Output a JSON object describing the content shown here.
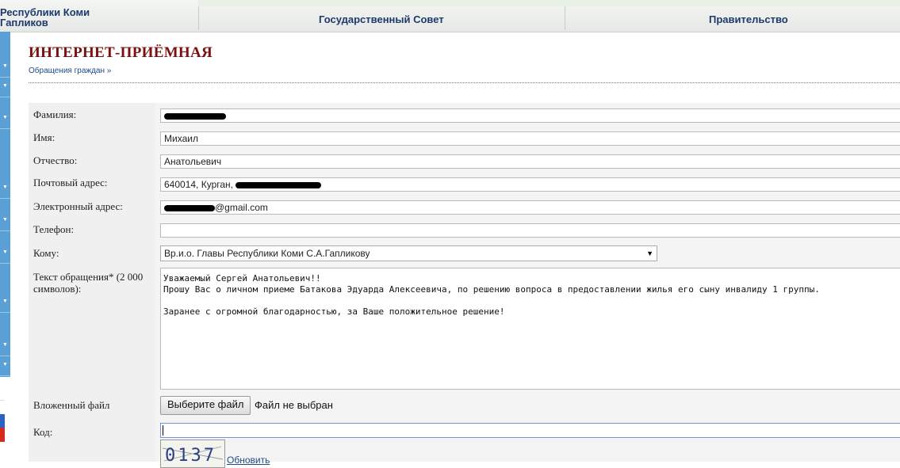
{
  "header": {
    "brand_line1": "Республики Коми",
    "brand_line2": "Гапликов",
    "nav": [
      {
        "label": "Государственный Совет"
      },
      {
        "label": "Правительство"
      }
    ]
  },
  "page": {
    "title": "ИНТЕРНЕТ-ПРИЁМНАЯ",
    "breadcrumb": "Обращения граждан",
    "breadcrumb_sep": "»"
  },
  "form": {
    "surname": {
      "label": "Фамилия:"
    },
    "name": {
      "label": "Имя:",
      "value": "Михаил"
    },
    "patronymic": {
      "label": "Отчество:",
      "value": "Анатольевич"
    },
    "postal": {
      "label": "Почтовый адрес:",
      "value": "640014, Курган,"
    },
    "email": {
      "label": "Электронный адрес:",
      "value": "@gmail.com"
    },
    "phone": {
      "label": "Телефон:",
      "value": ""
    },
    "to": {
      "label": "Кому:",
      "selected": "Вр.и.о. Главы Республики Коми С.А.Гапликову"
    },
    "message": {
      "label": "Текст обращения* (2 000 символов):",
      "value": "Уважаемый Сергей Анатольевич!!\nПрошу Вас о личном приеме Батакова Эдуарда Алексеевича, по решению вопроса в предоставлении жилья его сыну инвалиду 1 группы.\n\nЗаранее с огромной благодарностью, за Ваше положительное решение!"
    },
    "attachment": {
      "label": "Вложенный файл",
      "button": "Выберите файл",
      "status": "Файл не выбран"
    },
    "code": {
      "label": "Код:",
      "captcha_text": "0137",
      "refresh": "Обновить"
    }
  },
  "colors": {
    "title": "#7a1010",
    "link": "#1d4a8a",
    "sidebar": "#5aa0d6"
  }
}
